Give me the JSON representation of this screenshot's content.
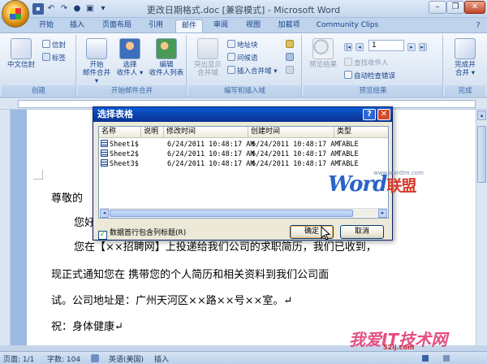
{
  "window": {
    "title": "更改日期格式.doc [兼容模式] - Microsoft Word"
  },
  "qat": {
    "save": "save-icon",
    "undo": "↶",
    "redo": "↷",
    "repeat": "●",
    "print": "▣"
  },
  "tabs": [
    "开始",
    "插入",
    "页面布局",
    "引用",
    "邮件",
    "审阅",
    "视图",
    "加载项",
    "Community Clips"
  ],
  "active_tab": "邮件",
  "ribbon": {
    "groups": {
      "create": {
        "label": "创建",
        "big": "中文信封",
        "small": [
          "信封",
          "标签"
        ]
      },
      "start_merge": {
        "label": "开始邮件合并",
        "buttons": [
          {
            "line1": "开始",
            "line2": "邮件合并 ▾"
          },
          {
            "line1": "选择",
            "line2": "收件人 ▾"
          },
          {
            "line1": "编辑",
            "line2": "收件人列表"
          }
        ]
      },
      "fields": {
        "label": "编写和插入域",
        "big_line1": "突出显示",
        "big_line2": "合并域",
        "small": [
          "地址块",
          "问候语",
          "插入合并域 ▾"
        ]
      },
      "preview": {
        "label": "预览结果",
        "big": "预览结果",
        "record": "1",
        "small": [
          "查找收件人",
          "自动检查错误"
        ]
      },
      "finish": {
        "label": "完成",
        "big_line1": "完成并",
        "big_line2": "合并 ▾"
      }
    }
  },
  "document": {
    "lines": [
      "尊敬的",
      "您好",
      "您在【××招聘网】上投递给我们公司的求职简历，我们已收到，",
      "现正式通知您在        携带您的个人简历和相关资料到我们公司面",
      "试。公司地址是：广州天河区××路××号××室。↵",
      "祝：身体健康↵"
    ]
  },
  "dialog": {
    "title": "选择表格",
    "columns": [
      "名称",
      "说明",
      "修改时间",
      "创建时间",
      "类型"
    ],
    "rows": [
      {
        "name": "Sheet1$",
        "desc": "",
        "modified": "6/24/2011  10:48:17 AM",
        "created": "6/24/2011  10:48:17 AM",
        "type": "TABLE"
      },
      {
        "name": "Sheet2$",
        "desc": "",
        "modified": "6/24/2011  10:48:17 AM",
        "created": "6/24/2011  10:48:17 AM",
        "type": "TABLE"
      },
      {
        "name": "Sheet3$",
        "desc": "",
        "modified": "6/24/2011  10:48:17 AM",
        "created": "6/24/2011  10:48:17 AM",
        "type": "TABLE"
      }
    ],
    "checkbox_label": "数据首行包含列标题(R)",
    "checkbox_checked": true,
    "ok": "确定",
    "cancel": "取消"
  },
  "status": {
    "page": "页面: 1/1",
    "words": "字数: 104",
    "lang": "英语(美国)",
    "mode": "插入"
  },
  "watermarks": {
    "word_latin": "Word",
    "word_cn": "联盟",
    "word_url": "www.wordlm.com",
    "site2": "我爱IT技术网",
    "site2_url": "52ij.com"
  }
}
